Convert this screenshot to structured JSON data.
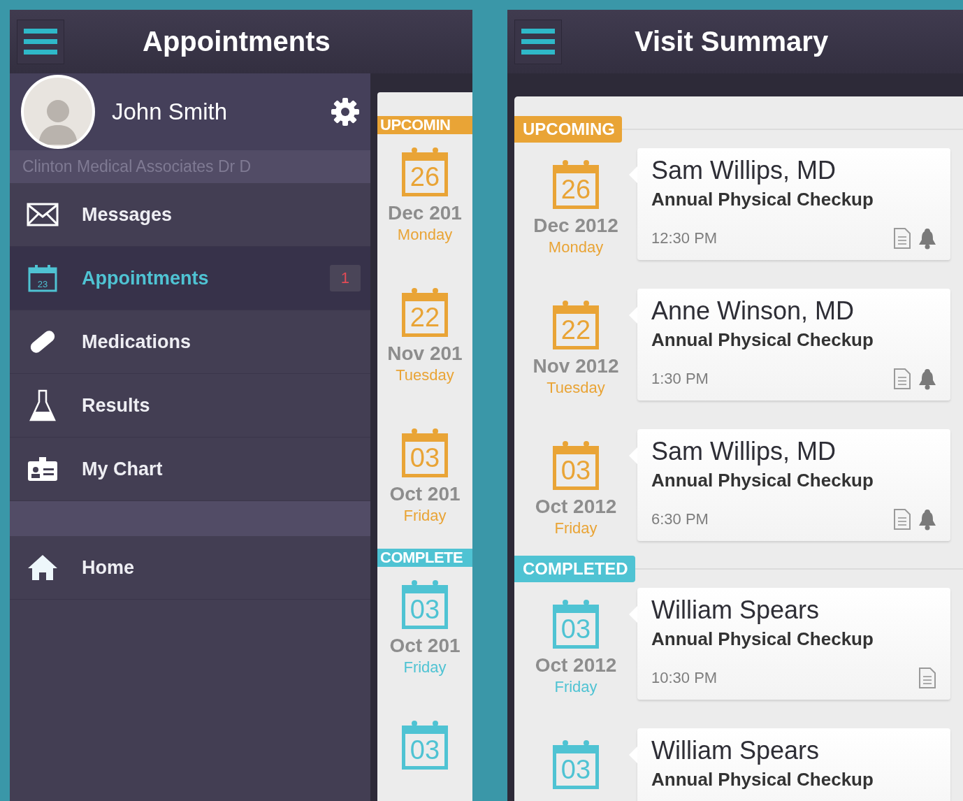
{
  "left_screen": {
    "header": {
      "title": "Appointments"
    },
    "profile": {
      "name": "John Smith",
      "subtitle": "Clinton Medical Associates Dr D"
    },
    "menu": [
      {
        "label": "Messages",
        "selected": false
      },
      {
        "label": "Appointments",
        "selected": true,
        "badge": "1",
        "icon_text": "23"
      },
      {
        "label": "Medications",
        "selected": false
      },
      {
        "label": "Results",
        "selected": false
      },
      {
        "label": "My Chart",
        "selected": false
      }
    ],
    "footer_menu": [
      {
        "label": "Home",
        "selected": false
      }
    ],
    "peek_list": {
      "sections": [
        {
          "label": "UPCOMIN",
          "kind": "upcoming",
          "entries": [
            {
              "day": "26",
              "month": "Dec 201",
              "weekday": "Monday"
            },
            {
              "day": "22",
              "month": "Nov 201",
              "weekday": "Tuesday"
            },
            {
              "day": "03",
              "month": "Oct 201",
              "weekday": "Friday"
            }
          ]
        },
        {
          "label": "COMPLETE",
          "kind": "completed",
          "entries": [
            {
              "day": "03",
              "month": "Oct 201",
              "weekday": "Friday"
            },
            {
              "day": "03"
            }
          ]
        }
      ]
    }
  },
  "right_screen": {
    "header": {
      "title": "Visit Summary"
    },
    "sections": [
      {
        "label": "UPCOMING",
        "kind": "upcoming",
        "entries": [
          {
            "day": "26",
            "month": "Dec 2012",
            "weekday": "Monday",
            "name": "Sam Willips, MD",
            "reason": "Annual Physical Checkup",
            "time": "12:30 PM",
            "reminder": true
          },
          {
            "day": "22",
            "month": "Nov 2012",
            "weekday": "Tuesday",
            "name": "Anne Winson, MD",
            "reason": "Annual Physical Checkup",
            "time": "1:30 PM",
            "reminder": true
          },
          {
            "day": "03",
            "month": "Oct 2012",
            "weekday": "Friday",
            "name": "Sam Willips, MD",
            "reason": "Annual Physical Checkup",
            "time": "6:30 PM",
            "reminder": true
          }
        ]
      },
      {
        "label": "COMPLETED",
        "kind": "completed",
        "entries": [
          {
            "day": "03",
            "month": "Oct 2012",
            "weekday": "Friday",
            "name": "William Spears",
            "reason": "Annual Physical Checkup",
            "time": "10:30 PM",
            "reminder": false
          },
          {
            "day": "03",
            "name": "William Spears",
            "reason": "Annual Physical Checkup"
          }
        ]
      }
    ]
  }
}
